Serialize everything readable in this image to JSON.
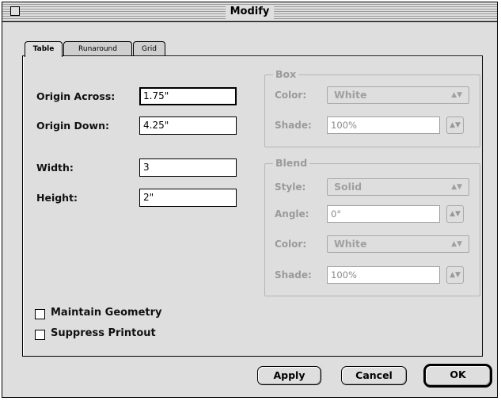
{
  "window": {
    "title": "Modify"
  },
  "tabs": [
    {
      "label": "Table"
    },
    {
      "label": "Runaround"
    },
    {
      "label": "Grid"
    }
  ],
  "fields": {
    "origin_across": {
      "label": "Origin Across:",
      "value": "1.75\""
    },
    "origin_down": {
      "label": "Origin Down:",
      "value": "4.25\""
    },
    "width": {
      "label": "Width:",
      "value": "3"
    },
    "height": {
      "label": "Height:",
      "value": "2\""
    }
  },
  "box": {
    "legend": "Box",
    "color": {
      "label": "Color:",
      "value": "White"
    },
    "shade": {
      "label": "Shade:",
      "value": "100%"
    }
  },
  "blend": {
    "legend": "Blend",
    "style": {
      "label": "Style:",
      "value": "Solid"
    },
    "angle": {
      "label": "Angle:",
      "value": "0°"
    },
    "color": {
      "label": "Color:",
      "value": "White"
    },
    "shade": {
      "label": "Shade:",
      "value": "100%"
    }
  },
  "checkboxes": {
    "maintain_geometry": {
      "label": "Maintain Geometry",
      "checked": false
    },
    "suppress_printout": {
      "label": "Suppress Printout",
      "checked": false
    }
  },
  "buttons": {
    "apply": "Apply",
    "cancel": "Cancel",
    "ok": "OK"
  }
}
